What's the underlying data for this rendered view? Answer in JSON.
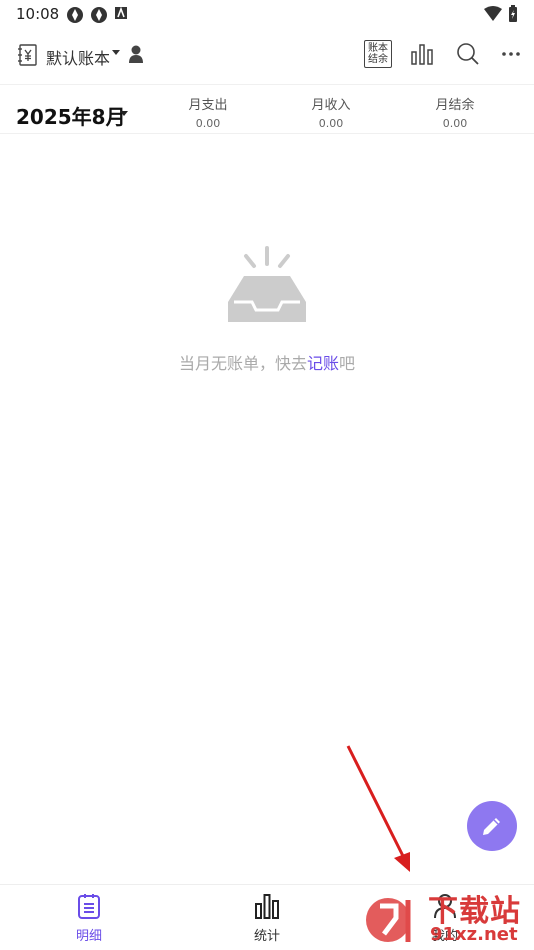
{
  "status_bar": {
    "time": "10:08"
  },
  "app_bar": {
    "book_name": "默认账本",
    "settle_label_line1": "账本",
    "settle_label_line2": "结余"
  },
  "summary": {
    "month": "2025年8月",
    "expense_label": "月支出",
    "expense_value": "0.00",
    "income_label": "月收入",
    "income_value": "0.00",
    "balance_label": "月结余",
    "balance_value": "0.00"
  },
  "empty_state": {
    "text_before": "当月无账单，快去",
    "link_text": "记账",
    "text_after": "吧"
  },
  "bottom_nav": {
    "tab_detail": "明细",
    "tab_stats": "统计",
    "tab_mine": "我的"
  },
  "watermark": {
    "brand": "下载站",
    "url": "91xz.net"
  },
  "colors": {
    "accent": "#6a4de8",
    "fab": "#8e78f0",
    "arrow": "#d81e1e"
  }
}
